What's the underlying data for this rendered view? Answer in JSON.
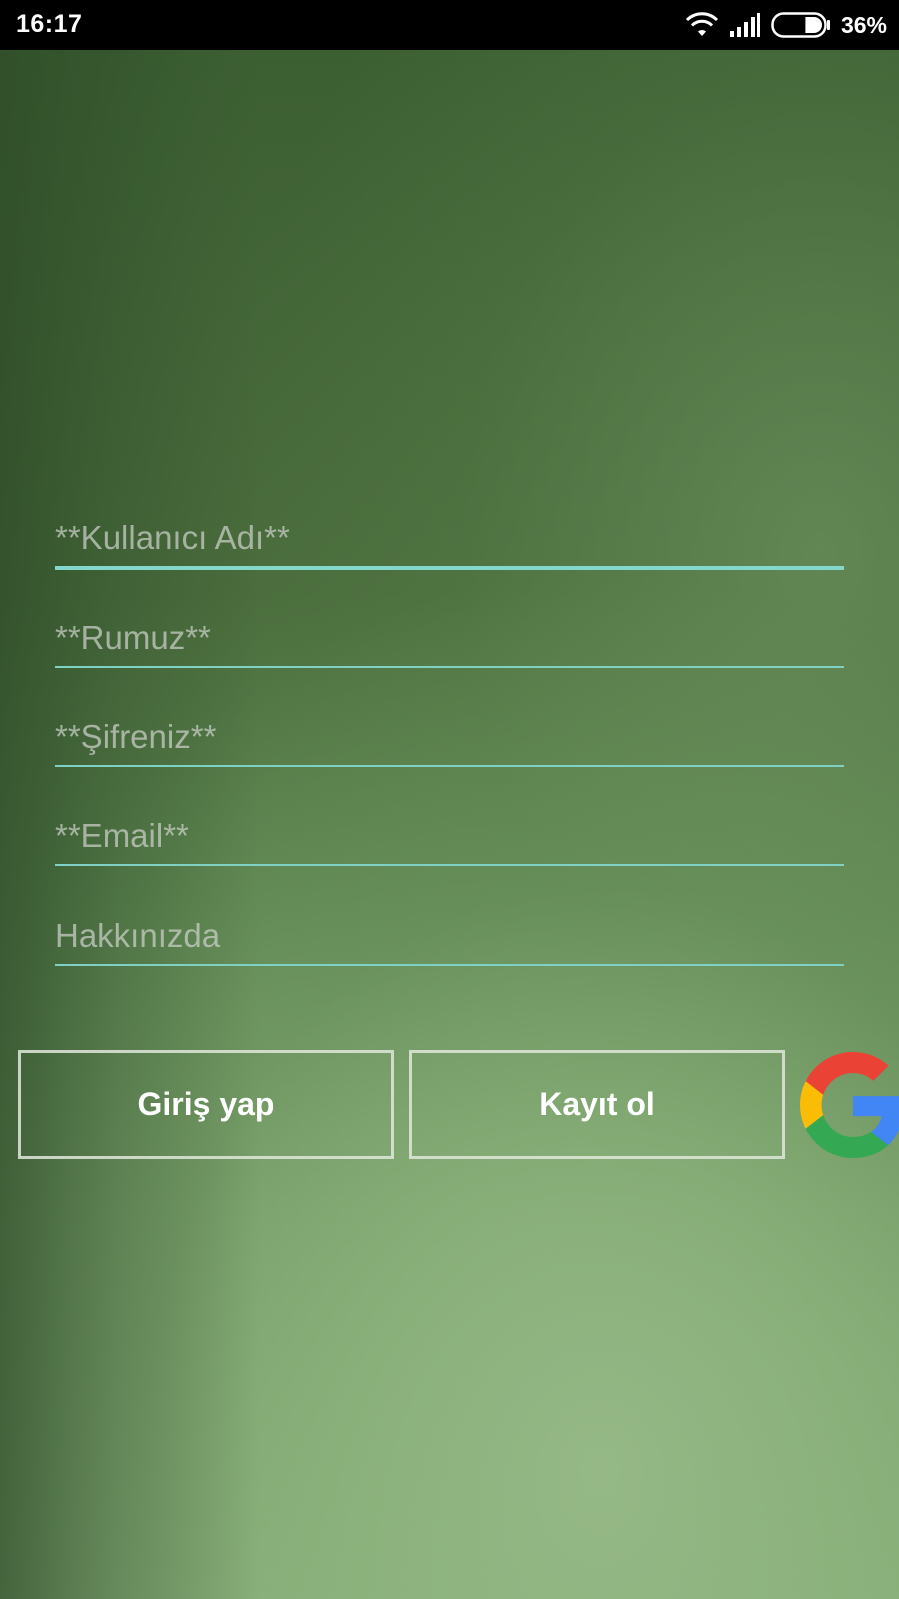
{
  "status_bar": {
    "time": "16:17",
    "battery_percent": "36%",
    "battery_level": 0.36,
    "icons": [
      "wifi-icon",
      "signal-icon",
      "battery-icon"
    ]
  },
  "form": {
    "fields": [
      {
        "name": "username",
        "placeholder": "**Kullanıcı Adı**",
        "value": ""
      },
      {
        "name": "nickname",
        "placeholder": "**Rumuz**",
        "value": ""
      },
      {
        "name": "password",
        "placeholder": "**Şifreniz**",
        "value": ""
      },
      {
        "name": "email",
        "placeholder": "**Email**",
        "value": ""
      },
      {
        "name": "about",
        "placeholder": "Hakkınızda",
        "value": ""
      }
    ]
  },
  "buttons": {
    "login_label": "Giriş yap",
    "register_label": "Kayıt ol",
    "google_icon": "google-g-logo"
  },
  "colors": {
    "field_underline": "#7fd1c3",
    "button_border": "#e1e8dc",
    "background_dark": "#3b5e31",
    "background_light": "#8db27f",
    "google_red": "#EA4335",
    "google_yellow": "#FBBC05",
    "google_green": "#34A853",
    "google_blue": "#4285F4"
  }
}
